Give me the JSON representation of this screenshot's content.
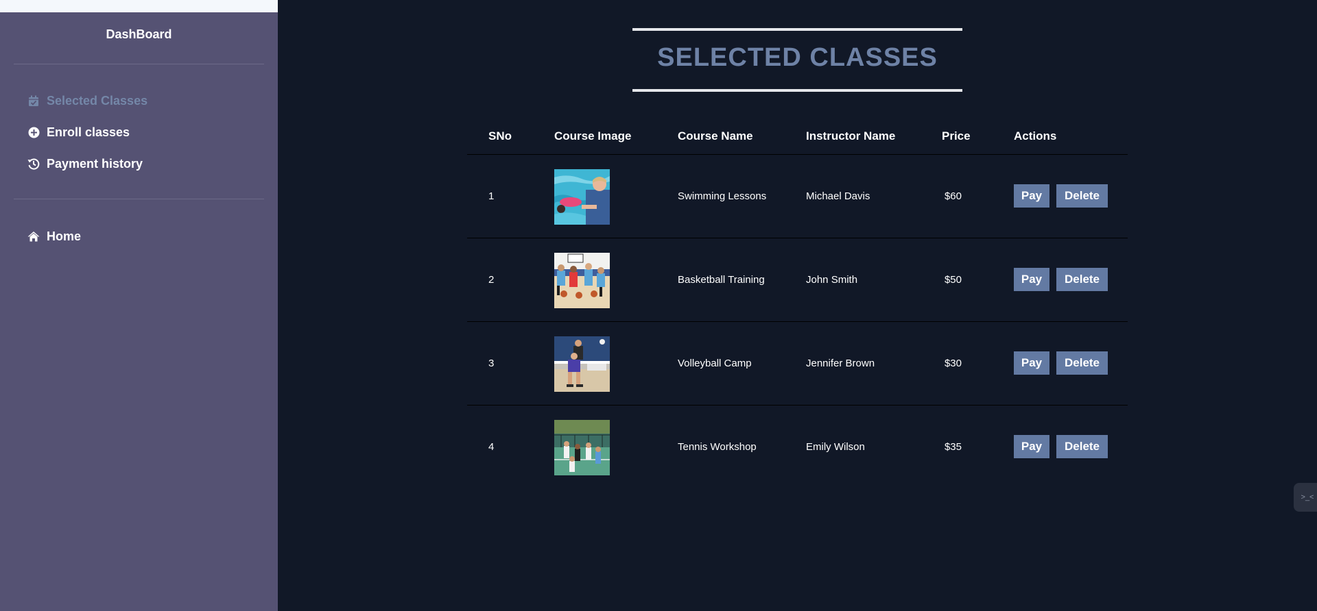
{
  "sidebar": {
    "brand": "DashBoard",
    "items": [
      {
        "label": "Selected Classes",
        "icon": "calendar-check-icon",
        "active": true
      },
      {
        "label": "Enroll classes",
        "icon": "plus-circle-icon",
        "active": false
      },
      {
        "label": "Payment history",
        "icon": "history-icon",
        "active": false
      }
    ],
    "home": {
      "label": "Home",
      "icon": "home-icon"
    }
  },
  "main": {
    "title": "SELECTED CLASSES",
    "columns": [
      "SNo",
      "Course Image",
      "Course Name",
      "Instructor Name",
      "Price",
      "Actions"
    ],
    "rows": [
      {
        "sno": "1",
        "course": "Swimming Lessons",
        "instructor": "Michael Davis",
        "price": "$60",
        "image": "swimming-image"
      },
      {
        "sno": "2",
        "course": "Basketball Training",
        "instructor": "John Smith",
        "price": "$50",
        "image": "basketball-image"
      },
      {
        "sno": "3",
        "course": "Volleyball Camp",
        "instructor": "Jennifer Brown",
        "price": "$30",
        "image": "volleyball-image"
      },
      {
        "sno": "4",
        "course": "Tennis Workshop",
        "instructor": "Emily Wilson",
        "price": "$35",
        "image": "tennis-image"
      }
    ],
    "pay_label": "Pay",
    "delete_label": "Delete"
  },
  "colors": {
    "sidebar_bg": "#555273",
    "main_bg": "#111827",
    "accent": "#637aa3",
    "title": "#6e82a6",
    "active_nav": "#7487a8"
  }
}
